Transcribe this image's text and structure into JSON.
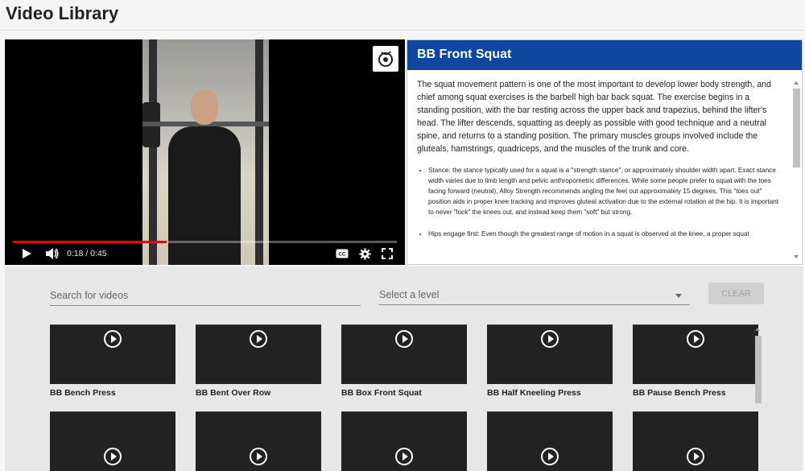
{
  "page": {
    "title": "Video Library"
  },
  "player": {
    "time": "0:18 / 0:45",
    "progress": 0.4,
    "icons": [
      "play-icon",
      "volume-icon",
      "captions-icon",
      "settings-icon",
      "fullscreen-icon",
      "brand-logo-icon"
    ]
  },
  "info": {
    "title": "BB Front Squat",
    "intro": "The squat movement pattern is one of the most important to develop lower body strength, and chief among squat exercises is the barbell high bar back squat. The exercise begins in a standing position, with the bar resting across the upper back and trapezius, behind the lifter's head. The lifter descends, squatting as deeply as possible with good technique and a neutral spine, and returns to a standing position. The primary muscles groups involved include the gluteals, hamstrings, quadriceps, and the muscles of the trunk and core.",
    "bullets": [
      "Stance: the stance typically used for a squat is a \"strength stance\", or approximately shoulder width apart. Exact stance width varies due to limb length and pelvic anthropometric differences. While some people prefer to squat with the toes facing forward (neutral), Alloy Strength recommends angling the feet out approximately 15 degrees. This \"toes out\" position aids in proper knee tracking and improves gluteal activation due to the external rotation at the hip. It is important to never \"lock\" the knees out, and instead keep them \"soft\" but strong.",
      "Hips engage first: Even though the greatest range of motion in a squat is observed at the knee, a proper squat"
    ]
  },
  "filters": {
    "search_placeholder": "Search for videos",
    "level_label": "Select a level",
    "clear_label": "CLEAR"
  },
  "videos": [
    {
      "title": "BB Bench Press"
    },
    {
      "title": "BB Bent Over Row"
    },
    {
      "title": "BB Box Front Squat"
    },
    {
      "title": "BB Half Kneeling Press"
    },
    {
      "title": "BB Pause Bench Press"
    },
    {
      "title": ""
    },
    {
      "title": ""
    },
    {
      "title": ""
    },
    {
      "title": ""
    },
    {
      "title": ""
    }
  ],
  "colors": {
    "accent": "#0d47a1",
    "progress": "#e00000"
  }
}
